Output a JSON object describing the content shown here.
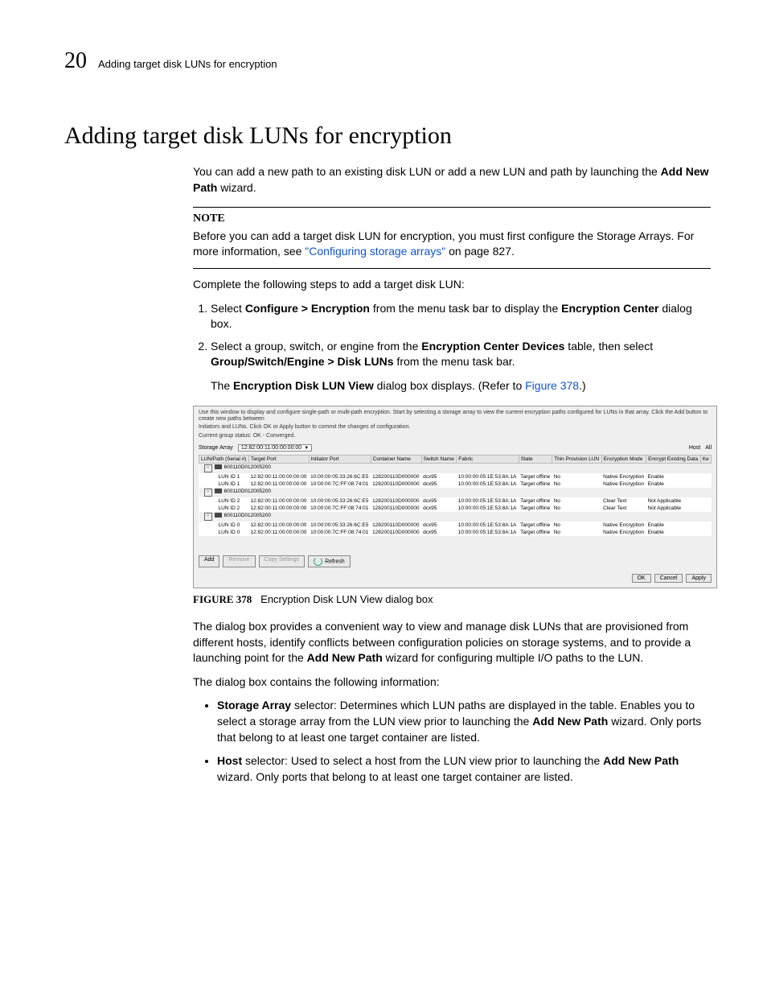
{
  "header": {
    "page_number": "20",
    "running_title": "Adding target disk LUNs for encryption"
  },
  "title": "Adding target disk LUNs for encryption",
  "intro_1": "You can add a new path to an existing disk LUN or add a new LUN and path by launching the ",
  "intro_bold": "Add New Path",
  "intro_2": " wizard.",
  "note_label": "NOTE",
  "note_1": "Before you can add a target disk LUN for encryption, you must first configure the Storage Arrays. For more information, see ",
  "note_link": "\"Configuring storage arrays\"",
  "note_2": " on page 827.",
  "complete": "Complete the following steps to add a target disk LUN:",
  "steps": [
    {
      "pre": "Select ",
      "b": "Configure > Encryption",
      "mid": " from the menu task bar to display the ",
      "b2": "Encryption Center",
      "post": " dialog box."
    },
    {
      "pre": "Select a group, switch, or engine from the ",
      "b": "Encryption Center Devices",
      "mid": " table, then select ",
      "b2": "Group/Switch/Engine > Disk LUNs",
      "post": " from the menu task bar."
    }
  ],
  "after_steps_1": "The ",
  "after_steps_b": "Encryption Disk LUN View",
  "after_steps_2": " dialog box displays. (Refer to ",
  "after_steps_link": "Figure 378",
  "after_steps_3": ".)",
  "screenshot": {
    "instr_1": "Use this window to display and configure single-path or multi-path encryption. Start by selecting a storage array to view the current encryption paths configured for LUNs in that array. Click the Add button to create new paths between",
    "instr_2": "Initiators and LUNs. Click OK or Apply button to commit the changes of configuration.",
    "instr_3": "Current group status: OK - Converged.",
    "storage_label": "Storage Array",
    "storage_value": "12:82:00:11:00:00:00:00",
    "host_label": "Host",
    "host_value": "All",
    "columns": [
      "LUN/Path (Serial #)",
      "Target Port",
      "Initiator Port",
      "Container Name",
      "Switch Name",
      "Fabric",
      "State",
      "Thin Provision LUN",
      "Encryption Mode",
      "Encrypt Existing Data",
      "Ke"
    ],
    "groups": [
      {
        "serial": "600110D012005200",
        "rows": [
          {
            "lun": "LUN ID 1",
            "tp": "12:82:00:11:00:00:00:00",
            "ip": "10:00:00:05:33:26:6C:E5",
            "cn": "128200110D000000",
            "sn": "dcx95",
            "fab": "10:00:00:05:1E:53:8A:1A",
            "st": "Target offline",
            "thin": "No",
            "em": "Native Encryption",
            "eed": "Enable"
          },
          {
            "lun": "LUN ID 1",
            "tp": "12:82:00:11:00:00:00:00",
            "ip": "10:00:00:7C:FF:08:74:01",
            "cn": "128200110D000000",
            "sn": "dcx95",
            "fab": "10:00:00:05:1E:53:8A:1A",
            "st": "Target offline",
            "thin": "No",
            "em": "Native Encryption",
            "eed": "Enable"
          }
        ]
      },
      {
        "serial": "600110D012005200",
        "rows": [
          {
            "lun": "LUN ID 2",
            "tp": "12:82:00:11:00:00:00:00",
            "ip": "10:00:00:05:33:26:6C:E5",
            "cn": "128200110D000000",
            "sn": "dcx95",
            "fab": "10:00:00:05:1E:53:8A:1A",
            "st": "Target offline",
            "thin": "No",
            "em": "Clear Text",
            "eed": "Not Applicable"
          },
          {
            "lun": "LUN ID 2",
            "tp": "12:82:00:11:00:00:00:00",
            "ip": "10:00:00:7C:FF:08:74:01",
            "cn": "128200110D000000",
            "sn": "dcx95",
            "fab": "10:00:00:05:1E:53:8A:1A",
            "st": "Target offline",
            "thin": "No",
            "em": "Clear Text",
            "eed": "Not Applicable"
          }
        ]
      },
      {
        "serial": "600110D012005200",
        "rows": [
          {
            "lun": "LUN ID 0",
            "tp": "12:82:00:11:00:00:00:00",
            "ip": "10:00:00:05:33:26:6C:E5",
            "cn": "128200110D000000",
            "sn": "dcx95",
            "fab": "10:00:00:05:1E:53:8A:1A",
            "st": "Target offline",
            "thin": "No",
            "em": "Native Encryption",
            "eed": "Enable"
          },
          {
            "lun": "LUN ID 0",
            "tp": "12:82:00:11:00:00:00:00",
            "ip": "10:00:00:7C:FF:08:74:01",
            "cn": "128200110D000000",
            "sn": "dcx95",
            "fab": "10:00:00:05:1E:53:8A:1A",
            "st": "Target offline",
            "thin": "No",
            "em": "Native Encryption",
            "eed": "Enable"
          }
        ]
      }
    ],
    "buttons": {
      "add": "Add",
      "remove": "Remove",
      "copy": "Copy Settings",
      "refresh": "Refresh",
      "ok": "OK",
      "cancel": "Cancel",
      "apply": "Apply"
    }
  },
  "figure": {
    "label": "FIGURE 378",
    "caption": "Encryption Disk LUN View dialog box"
  },
  "para1_a": "The dialog box provides a convenient way to view and manage disk LUNs that are provisioned from different hosts, identify conflicts between configuration policies on storage systems, and to provide a launching point for the ",
  "para1_b": "Add New Path",
  "para1_c": " wizard for configuring multiple I/O paths to the LUN.",
  "para2": "The dialog box contains the following information:",
  "bullets": [
    {
      "b": "Storage Array",
      "t1": " selector: Determines which LUN paths are displayed in the table. Enables you to select a storage array from the LUN view prior to launching the ",
      "b2": "Add New Path",
      "t2": " wizard. Only ports that belong to at least one target container are listed."
    },
    {
      "b": "Host",
      "t1": " selector: Used to select a host from the LUN view prior to launching the ",
      "b2": "Add New Path",
      "t2": " wizard. Only ports that belong to at least one target container are listed."
    }
  ]
}
